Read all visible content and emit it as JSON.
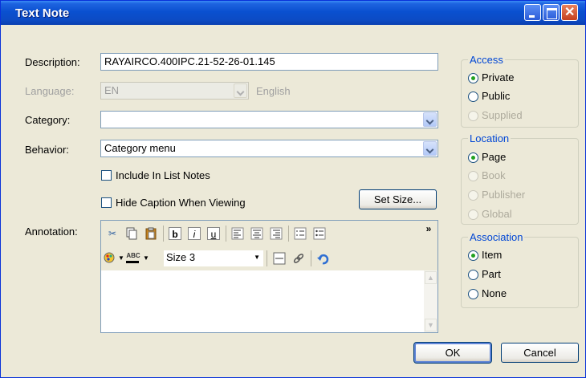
{
  "window": {
    "title": "Text Note"
  },
  "form": {
    "description_label": "Description:",
    "description_value": "RAYAIRCO.400IPC.21-52-26-01.145",
    "language_label": "Language:",
    "language_value": "EN",
    "language_name": "English",
    "category_label": "Category:",
    "category_value": "",
    "behavior_label": "Behavior:",
    "behavior_value": "Category menu",
    "include_in_list_notes_label": "Include In List Notes",
    "include_in_list_notes_checked": false,
    "hide_caption_label": "Hide Caption When Viewing",
    "hide_caption_checked": false,
    "set_size_label": "Set Size...",
    "annotation_label": "Annotation:"
  },
  "editor": {
    "toolbar1": [
      "cut-icon",
      "copy-icon",
      "paste-icon",
      "bold-icon",
      "italic-icon",
      "underline-icon",
      "align-left-icon",
      "align-center-icon",
      "align-right-icon",
      "numbered-list-icon",
      "bullet-list-icon"
    ],
    "toolbar1_glyphs": {
      "bold": "b",
      "italic": "i",
      "underline": "u"
    },
    "overflow_glyph": "»",
    "font_size_value": "Size 3",
    "spell_glyph": "ABC",
    "text": ""
  },
  "access": {
    "title": "Access",
    "options": [
      {
        "label": "Private",
        "selected": true,
        "enabled": true
      },
      {
        "label": "Public",
        "selected": false,
        "enabled": true
      },
      {
        "label": "Supplied",
        "selected": false,
        "enabled": false
      }
    ]
  },
  "location": {
    "title": "Location",
    "options": [
      {
        "label": "Page",
        "selected": true,
        "enabled": true
      },
      {
        "label": "Book",
        "selected": false,
        "enabled": false
      },
      {
        "label": "Publisher",
        "selected": false,
        "enabled": false
      },
      {
        "label": "Global",
        "selected": false,
        "enabled": false
      }
    ]
  },
  "association": {
    "title": "Association",
    "options": [
      {
        "label": "Item",
        "selected": true,
        "enabled": true
      },
      {
        "label": "Part",
        "selected": false,
        "enabled": true
      },
      {
        "label": "None",
        "selected": false,
        "enabled": true
      }
    ]
  },
  "buttons": {
    "ok": "OK",
    "cancel": "Cancel"
  },
  "colors": {
    "titlebar": "#0A50D0",
    "group_title": "#0046D5",
    "face": "#ECE9D8"
  }
}
